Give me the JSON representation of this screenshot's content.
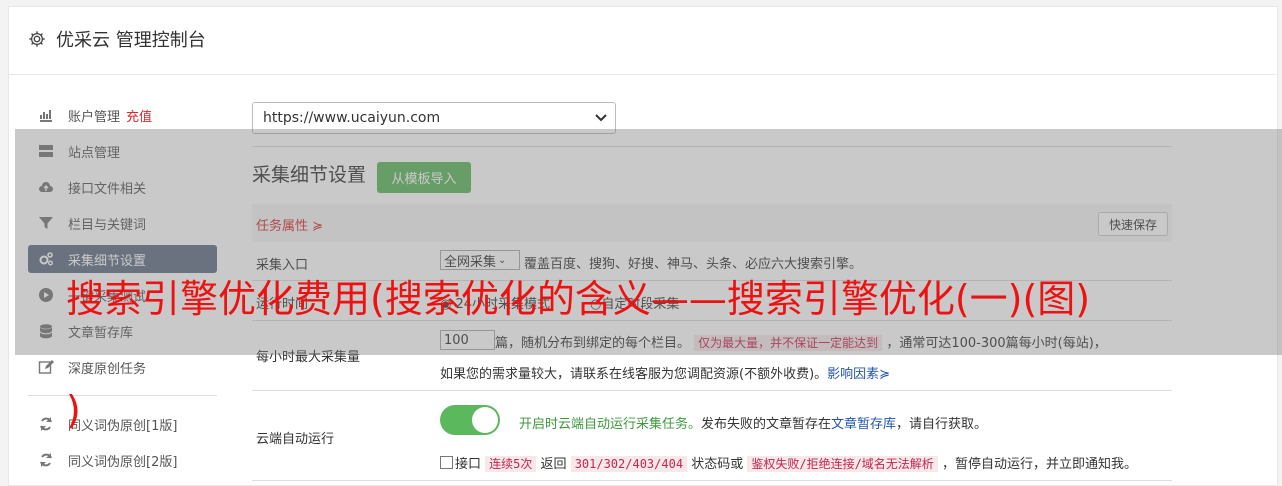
{
  "header": {
    "title": "优采云 管理控制台"
  },
  "sidebar": {
    "items": [
      {
        "label": "账户管理",
        "extra": "充值",
        "icon": "bar-chart-icon"
      },
      {
        "label": "站点管理",
        "icon": "server-icon"
      },
      {
        "label": "接口文件相关",
        "icon": "cloud-upload-icon"
      },
      {
        "label": "栏目与关键词",
        "icon": "filter-icon"
      },
      {
        "label": "采集细节设置",
        "icon": "gears-icon",
        "active": true
      },
      {
        "label": "一键采集测试",
        "icon": "play-circle-icon"
      },
      {
        "label": "文章暂存库",
        "icon": "database-icon"
      },
      {
        "label": "深度原创任务",
        "icon": "edit-icon"
      },
      {
        "label": "同义词伪原创[1版]",
        "icon": "refresh-icon"
      },
      {
        "label": "同义词伪原创[2版]",
        "icon": "refresh-icon"
      }
    ]
  },
  "site_select": {
    "value": "https://www.ucaiyun.com"
  },
  "section": {
    "title": "采集细节设置",
    "import_button": "从模板导入"
  },
  "task_attr": {
    "label": "任务属性",
    "save_button": "快速保存"
  },
  "rows": {
    "entry": {
      "label": "采集入口",
      "select_value": "全网采集",
      "desc": "覆盖百度、搜狗、好搜、神马、头条、必应六大搜索引擎。"
    },
    "runtime": {
      "label": "运行时间",
      "opt1": "24小时采集模式",
      "opt2": "自定时段采集"
    },
    "hourly": {
      "label": "每小时最大采集量",
      "input_value": "100",
      "text1": "篇，随机分布到绑定的每个栏目。",
      "warn": "仅为最大量，并不保证一定能达到",
      "text2": "，通常可达100-300篇每小时(每站)，",
      "text3": "如果您的需求量较大，请联系在线客服为您调配资源(不额外收费)。",
      "link": "影响因素"
    },
    "cloud": {
      "label": "云端自动运行",
      "enabled_text": "开启时云端自动运行采集任务。",
      "text1": "发布失败的文章暂存在",
      "link": "文章暂存库",
      "text2": "，请自行获取。",
      "cb_prefix": "接口",
      "warn1": "连续5次",
      "mid1": "返回",
      "warn2": "301/302/403/404",
      "mid2": "状态码或",
      "warn3": "鉴权失败/拒绝连接/域名无法解析",
      "tail": "，暂停自动运行，并立即通知我。"
    }
  },
  "overlay_title": {
    "line1": "搜索引擎优化费用(搜索优化的含义——搜索引擎优化(一)(图)",
    "line2": ")"
  },
  "colors": {
    "accent_green": "#5cb85c",
    "active_sidebar": "#5f6f82",
    "overlay_text": "#ee1111"
  }
}
